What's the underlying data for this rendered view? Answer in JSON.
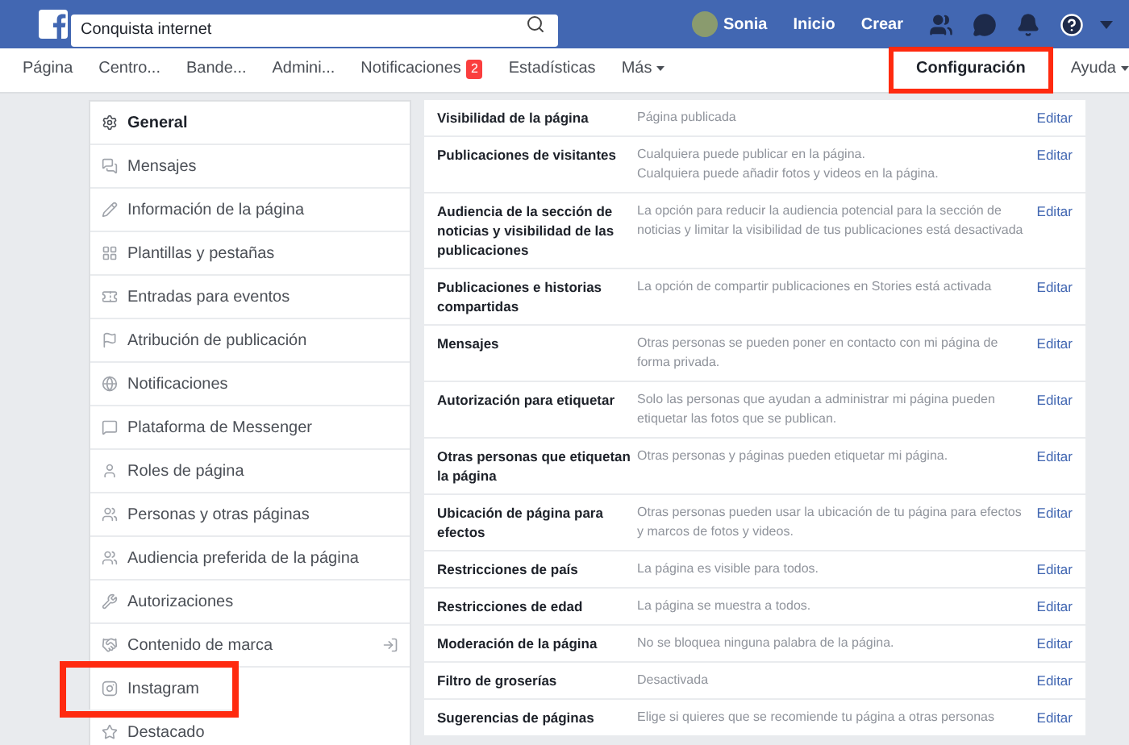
{
  "topbar": {
    "search": {
      "value": "Conquista internet"
    },
    "user": "Sonia",
    "links": [
      "Inicio",
      "Crear"
    ]
  },
  "nav": {
    "tabs": [
      {
        "label": "Página",
        "selected": false,
        "highlighted": false
      },
      {
        "label": "Centro...",
        "selected": false,
        "highlighted": false
      },
      {
        "label": "Bande...",
        "selected": false,
        "highlighted": false
      },
      {
        "label": "Admini...",
        "selected": false,
        "highlighted": false
      },
      {
        "label": "Notificaciones",
        "badge": "2",
        "selected": false,
        "highlighted": false
      },
      {
        "label": "Estadísticas",
        "selected": false,
        "highlighted": false
      },
      {
        "label": "Más",
        "kind": "dropdown",
        "selected": false,
        "highlighted": false
      },
      {
        "label": "Configuración",
        "selected": true,
        "highlighted": true
      },
      {
        "label": "Ayuda",
        "kind": "dropdown",
        "selected": false,
        "highlighted": false
      }
    ]
  },
  "sidebar": {
    "items": [
      {
        "label": "General",
        "selected": true,
        "highlighted": false
      },
      {
        "label": "Mensajes",
        "selected": false,
        "highlighted": false
      },
      {
        "label": "Información de la página",
        "selected": false,
        "highlighted": false
      },
      {
        "label": "Plantillas y pestañas",
        "selected": false,
        "highlighted": false
      },
      {
        "label": "Entradas para eventos",
        "selected": false,
        "highlighted": false
      },
      {
        "label": "Atribución de publicación",
        "selected": false,
        "highlighted": false
      },
      {
        "label": "Notificaciones",
        "selected": false,
        "highlighted": false
      },
      {
        "label": "Plataforma de Messenger",
        "selected": false,
        "highlighted": false
      },
      {
        "label": "Roles de página",
        "selected": false,
        "highlighted": false
      },
      {
        "label": "Personas y otras páginas",
        "selected": false,
        "highlighted": false
      },
      {
        "label": "Audiencia preferida de la página",
        "selected": false,
        "highlighted": false
      },
      {
        "label": "Autorizaciones",
        "selected": false,
        "highlighted": false
      },
      {
        "label": "Contenido de marca",
        "selected": false,
        "highlighted": false
      },
      {
        "label": "Instagram",
        "selected": false,
        "highlighted": true
      },
      {
        "label": "Destacado",
        "selected": false,
        "highlighted": false
      }
    ]
  },
  "settings": {
    "rows": [
      {
        "label": "Visibilidad de la página",
        "value": "Página publicada",
        "action": "Editar"
      },
      {
        "label": "Publicaciones de visitantes",
        "value": "Cualquiera puede publicar en la página.\nCualquiera puede añadir fotos y videos en la página.",
        "action": "Editar"
      },
      {
        "label": "Audiencia de la sección de noticias y visibilidad de las publicaciones",
        "value": "La opción para reducir la audiencia potencial para la sección de noticias y limitar la visibilidad de tus publicaciones está desactivada",
        "action": "Editar"
      },
      {
        "label": "Publicaciones e historias compartidas",
        "value": "La opción de compartir publicaciones en Stories está activada",
        "action": "Editar"
      },
      {
        "label": "Mensajes",
        "value": "Otras personas se pueden poner en contacto con mi página de forma privada.",
        "action": "Editar"
      },
      {
        "label": "Autorización para etiquetar",
        "value": "Solo las personas que ayudan a administrar mi página pueden etiquetar las fotos que se publican.",
        "action": "Editar"
      },
      {
        "label": "Otras personas que etiquetan la página",
        "value": "Otras personas y páginas pueden etiquetar mi página.",
        "action": "Editar"
      },
      {
        "label": "Ubicación de página para efectos",
        "value": "Otras personas pueden usar la ubicación de tu página para efectos y marcos de fotos y videos.",
        "action": "Editar"
      },
      {
        "label": "Restricciones de país",
        "value": "La página es visible para todos.",
        "action": "Editar"
      },
      {
        "label": "Restricciones de edad",
        "value": "La página se muestra a todos.",
        "action": "Editar"
      },
      {
        "label": "Moderación de la página",
        "value": "No se bloquea ninguna palabra de la página.",
        "action": "Editar"
      },
      {
        "label": "Filtro de groserías",
        "value": "Desactivada",
        "action": "Editar"
      },
      {
        "label": "Sugerencias de páginas",
        "value": "Elige si quieres que se recomiende tu página a otras personas",
        "action": "Editar"
      }
    ]
  }
}
